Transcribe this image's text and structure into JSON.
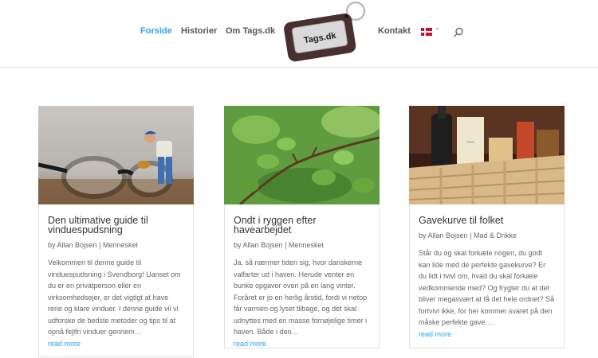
{
  "header": {
    "nav": [
      {
        "label": "Forside",
        "active": true
      },
      {
        "label": "Historier",
        "active": false
      },
      {
        "label": "Om Tags.dk",
        "active": false
      },
      {
        "label": "Kontakt",
        "active": false
      }
    ],
    "logo_text": "Tags.dk",
    "language": "Dansk",
    "accent_color": "#2ea3f2"
  },
  "posts": [
    {
      "title": "Den ultimative guide til vinduespudsning",
      "author": "Allan Bojsen",
      "category": "Mennesket",
      "separator": "|",
      "by": "by",
      "excerpt": "Velkommen til denne guide til vinduespudsning i Svendborg! Uanset om du er en privatperson eller en virksomhedsejer, er det vigtigt at have rene og klare vinduer. I denne guide vil vi udforske de bedste metoder og tips til at opnå fejlfri vinduer gennem…",
      "read_more": "read more"
    },
    {
      "title": "Ondt i ryggen efter havearbejdet",
      "author": "Allan Bojsen",
      "category": "Mennesket",
      "separator": "|",
      "by": "by",
      "excerpt": "Ja, så nærmer tiden sig, hvor danskerne valfarter ud i haven. Herude venter en bunke opgaver oven på en lang vinter. Foråret er jo en herlig årstid, fordi vi netop får varmen og lyset tilbage, og det skal udnyttes med en masse fornøjelige timer i haven. Både i den…",
      "read_more": "read more"
    },
    {
      "title": "Gavekurve til folket",
      "author": "Allan Bojsen",
      "category": "Mad & Drikke",
      "separator": "|",
      "by": "by",
      "excerpt": "Står du og skal forkæle nogen, du godt kan lide med de perfekte gavekurve? Er du lidt i tvivl om, hvad du skal forkæle vedkommende med? Og frygter du at det bliver megasvært at få det hele ordnet? Så fortvivl ikke, for her kommer svaret på den måske perfekte gave….",
      "read_more": "read more"
    }
  ]
}
